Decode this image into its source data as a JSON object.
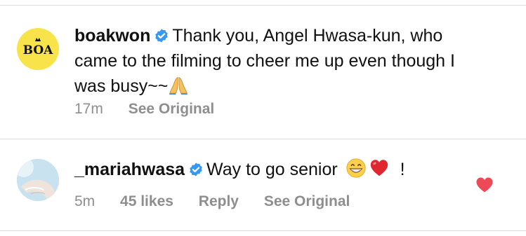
{
  "comments": [
    {
      "username": "boakwon",
      "avatar_text": "BOA",
      "text": "Thank you, Angel Hwasa-kun, who came to the filming to cheer me up even though I was busy~~",
      "emoji": "folded-hands",
      "time": "17m",
      "see_original": "See Original"
    },
    {
      "username": "_mariahwasa",
      "text_before": "Way to go senior",
      "emojis": [
        "grinning-face",
        "red-heart"
      ],
      "text_after": "!",
      "time": "5m",
      "likes": "45 likes",
      "reply": "Reply",
      "see_original": "See Original",
      "liked": true
    }
  ],
  "colors": {
    "verified": "#3897f0",
    "heart": "#ed4956",
    "meta_text": "#8e8e8e",
    "avatar_bg": "#f9e34b"
  }
}
